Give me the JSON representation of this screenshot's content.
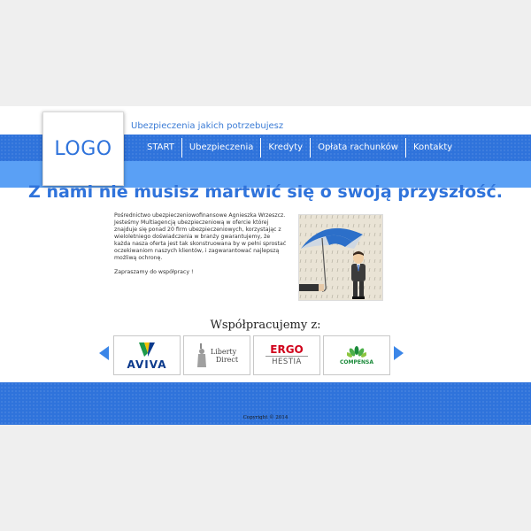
{
  "header": {
    "logo_text": "LOGO",
    "tagline": "Ubezpieczenia jakich potrzebujesz"
  },
  "nav": {
    "items": [
      {
        "label": "START"
      },
      {
        "label": "Ubezpieczenia"
      },
      {
        "label": "Kredyty"
      },
      {
        "label": "Opłata rachunków"
      },
      {
        "label": "Kontakty"
      }
    ]
  },
  "main": {
    "headline": "Z nami nie musisz martwić się o swoją przyszłość.",
    "about_paragraph": "Pośrednictwo ubezpieczeniowofinansowe Agnieszka Wrzeszcz. Jesteśmy Multiagencją ubezpieczeniową w ofercie której znajduje się ponad 20 firm ubezpieczeniowych, korzystając z wieloletniego doświadczenia w branży gwarantujemy, że każda nasza oferta jest tak skonstruowana by w pełni sprostać oczekiwaniom naszych klientów, i zagwarantować najlepszą możliwą ochronę.",
    "invitation": "Zapraszamy do współpracy !"
  },
  "partners": {
    "title": "Współpracujemy z:",
    "logos": [
      {
        "name": "AVIVA"
      },
      {
        "line1": "Liberty",
        "line2": "Direct"
      },
      {
        "line1": "ERGO",
        "line2": "HESTIA"
      },
      {
        "name": "COMPENSA"
      }
    ]
  },
  "footer": {
    "copyright": "Copyright © 2014"
  },
  "colors": {
    "primary_blue": "#2f73db",
    "light_blue": "#5aa0f5",
    "page_background": "#efefef"
  }
}
